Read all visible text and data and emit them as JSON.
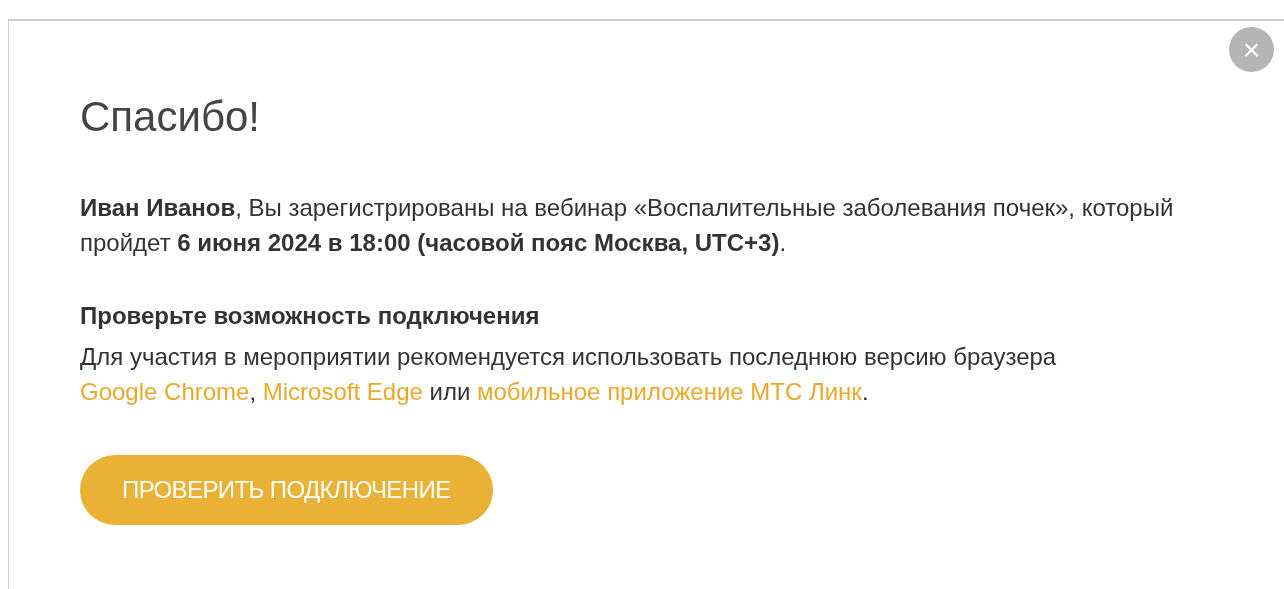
{
  "dialog": {
    "close_label": "×",
    "title": "Спасибо!",
    "message": "**Иван Иванов**, Вы зарегистрированы на вебинар «Воспалительные заболевания почек», который пройдет **6 июня 2024 в 18:00 (часовой пояс Москва, UTC+3)**.",
    "section_heading": "Проверьте возможность подключения",
    "info": [
      {
        "kind": "text",
        "text": "Для участия в мероприятии рекомендуется использовать последнюю версию браузера "
      },
      {
        "kind": "link",
        "text": "Google Chrome"
      },
      {
        "kind": "text",
        "text": ", "
      },
      {
        "kind": "link",
        "text": "Microsoft Edge"
      },
      {
        "kind": "text",
        "text": " или "
      },
      {
        "kind": "link",
        "text": "мобильное приложение МТС Линк"
      },
      {
        "kind": "text",
        "text": "."
      }
    ],
    "button": "ПРОВЕРИТЬ ПОДКЛЮЧЕНИЕ"
  }
}
